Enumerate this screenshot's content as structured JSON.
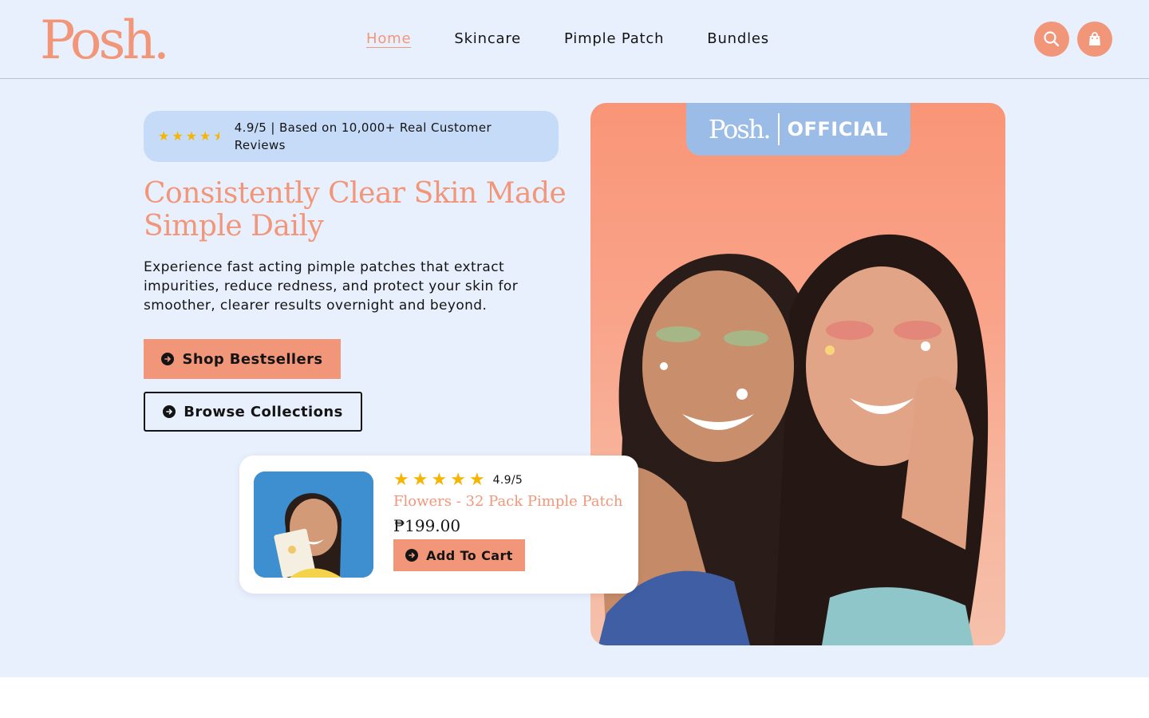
{
  "brand": {
    "logo_text": "Posh",
    "logo_dot": "."
  },
  "nav": {
    "items": [
      {
        "label": "Home",
        "active": true
      },
      {
        "label": "Skincare",
        "active": false
      },
      {
        "label": "Pimple Patch",
        "active": false
      },
      {
        "label": "Bundles",
        "active": false
      }
    ]
  },
  "header_icons": {
    "search": "search-icon",
    "cart": "shopping-bag-icon"
  },
  "hero": {
    "rating_stars": 4.5,
    "rating_text": "4.9/5 | Based on 10,000+ Real Customer Reviews",
    "headline": "Consistently Clear Skin Made Simple Daily",
    "subtext": "Experience fast acting pimple patches that extract impurities, reduce redness, and protect your skin for smoother, clearer results overnight and beyond.",
    "primary_button": "Shop Bestsellers",
    "secondary_button": "Browse Collections",
    "image_tag_logo": "Posh.",
    "image_tag_text": "OFFICIAL"
  },
  "product_card": {
    "stars": 5,
    "score": "4.9/5",
    "name": "Flowers - 32 Pack Pimple Patch",
    "price": "₱199.00",
    "button": "Add To Cart"
  },
  "colors": {
    "accent": "#f2967a",
    "background": "#e9f0fd",
    "banner": "#c6dbf7",
    "tag": "#9bbce6",
    "star": "#f6b500",
    "text": "#141414"
  }
}
